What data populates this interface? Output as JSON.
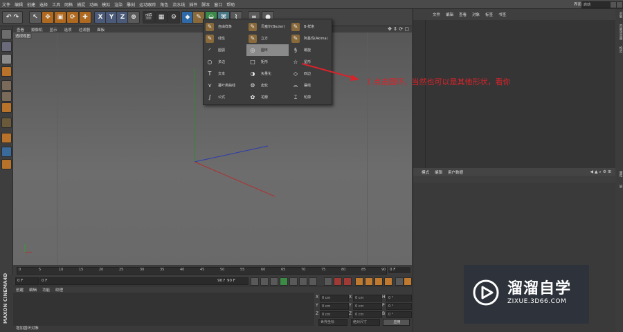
{
  "menubar": {
    "items": [
      "文件",
      "编辑",
      "创建",
      "选择",
      "工具",
      "网格",
      "捕捉",
      "动画",
      "模拟",
      "渲染",
      "雕刻",
      "运动跟踪",
      "角色",
      "流水线",
      "插件",
      "脚本",
      "窗口",
      "帮助"
    ],
    "layout_label": "界面",
    "layout_value": "启动"
  },
  "toolbar": {
    "axis_x": "X",
    "axis_y": "Y",
    "axis_z": "Z"
  },
  "viewport": {
    "menu": [
      "查看",
      "摄像机",
      "显示",
      "选项",
      "过滤器",
      "面板"
    ],
    "camera_label": "透视视图",
    "nav_icons": "✥ ⇕ ⟳ ▢"
  },
  "spline_menu": {
    "items": [
      {
        "label": "自由样条",
        "icon": "pen-icon"
      },
      {
        "label": "贝塞尔(Bezier)",
        "icon": "pen-icon"
      },
      {
        "label": "B-样条",
        "icon": "pen-icon"
      },
      {
        "label": "线性",
        "icon": "pen-icon"
      },
      {
        "label": "立方",
        "icon": "pen-icon"
      },
      {
        "label": "阿基玛(Akima)",
        "icon": "pen-icon"
      },
      {
        "label": "圆弧",
        "icon": "arc-icon"
      },
      {
        "label": "圆环",
        "icon": "circle-icon"
      },
      {
        "label": "螺旋",
        "icon": "helix-icon"
      },
      {
        "label": "多边",
        "icon": "polygon-icon"
      },
      {
        "label": "矩形",
        "icon": "rectangle-icon"
      },
      {
        "label": "星形",
        "icon": "star-icon"
      },
      {
        "label": "文本",
        "icon": "text-icon"
      },
      {
        "label": "矢量化",
        "icon": "vectorize-icon"
      },
      {
        "label": "四边",
        "icon": "diamond-icon"
      },
      {
        "label": "蔓叶类曲线",
        "icon": "cissoid-icon"
      },
      {
        "label": "齿轮",
        "icon": "gear-icon"
      },
      {
        "label": "摆线",
        "icon": "cycloid-icon"
      },
      {
        "label": "公式",
        "icon": "formula-icon"
      },
      {
        "label": "花瓣",
        "icon": "flower-icon"
      },
      {
        "label": "轮廓",
        "icon": "profile-icon"
      }
    ],
    "highlighted": "圆环"
  },
  "annotation": {
    "text": "1.点击圆环，当然也可以是其他形状，看你",
    "color": "#d8232a"
  },
  "timeline": {
    "ticks": [
      "0",
      "5",
      "10",
      "15",
      "20",
      "25",
      "30",
      "35",
      "40",
      "45",
      "50",
      "55",
      "60",
      "65",
      "70",
      "75",
      "80",
      "85",
      "90"
    ],
    "current_frame": "0 F"
  },
  "transport": {
    "start_field": "0 F",
    "preview_start": "0 F",
    "preview_end": "90 F",
    "end_field": "90 F"
  },
  "material_panel": {
    "menu": [
      "创建",
      "编辑",
      "功能",
      "纹理"
    ]
  },
  "coordinates": {
    "rows": [
      {
        "a": "X",
        "a_val": "0 cm",
        "b": "X",
        "b_val": "0 cm",
        "c": "H",
        "c_val": "0 °"
      },
      {
        "a": "Y",
        "a_val": "0 cm",
        "b": "Y",
        "b_val": "0 cm",
        "c": "P",
        "c_val": "0 °"
      },
      {
        "a": "Z",
        "a_val": "0 cm",
        "b": "Z",
        "b_val": "0 cm",
        "c": "B",
        "c_val": "0 °"
      }
    ],
    "mode1": "世界坐标",
    "mode2": "绝对尺寸",
    "apply_label": "应用"
  },
  "object_manager": {
    "menu": [
      "文件",
      "编辑",
      "查看",
      "对象",
      "标签",
      "书签"
    ]
  },
  "attributes": {
    "menu": [
      "模式",
      "编辑",
      "用户数据"
    ]
  },
  "side_tabs": [
    "对象",
    "内容浏览器",
    "构造",
    "属性",
    "层"
  ],
  "status": {
    "text": "增加圆环对象"
  },
  "brand": {
    "maxon": "MAXON CINEMA4D"
  },
  "watermark": {
    "title": "溜溜自学",
    "subtitle": "ZIXUE.3D66.COM"
  }
}
